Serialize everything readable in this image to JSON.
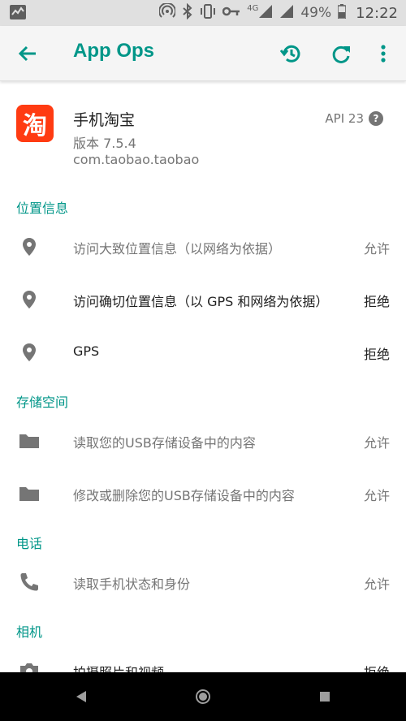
{
  "status_bar": {
    "network_label": "4G",
    "battery": "49%",
    "time": "12:22"
  },
  "app_bar": {
    "title": "App Ops"
  },
  "app": {
    "name": "手机淘宝",
    "icon_text": "淘",
    "version": "版本 7.5.4",
    "package": "com.taobao.taobao",
    "api": "API 23"
  },
  "sections": {
    "location": {
      "title": "位置信息",
      "rows": [
        {
          "label": "访问大致位置信息（以网络为依据）",
          "status": "允许"
        },
        {
          "label": "访问确切位置信息（以 GPS 和网络为依据）",
          "status": "拒绝"
        },
        {
          "label": "GPS",
          "status": "拒绝"
        }
      ]
    },
    "storage": {
      "title": "存储空间",
      "rows": [
        {
          "label": "读取您的USB存储设备中的内容",
          "status": "允许"
        },
        {
          "label": "修改或删除您的USB存储设备中的内容",
          "status": "允许"
        }
      ]
    },
    "phone": {
      "title": "电话",
      "rows": [
        {
          "label": "读取手机状态和身份",
          "status": "允许"
        }
      ]
    },
    "camera": {
      "title": "相机",
      "rows": [
        {
          "label": "拍摄照片和视频",
          "status": "拒绝"
        }
      ]
    }
  },
  "colors": {
    "accent": "#009688",
    "app_bar_bg": "#f5f5f5",
    "status_bar_bg": "#e0e0e0",
    "nav_bar_bg": "#000000"
  }
}
